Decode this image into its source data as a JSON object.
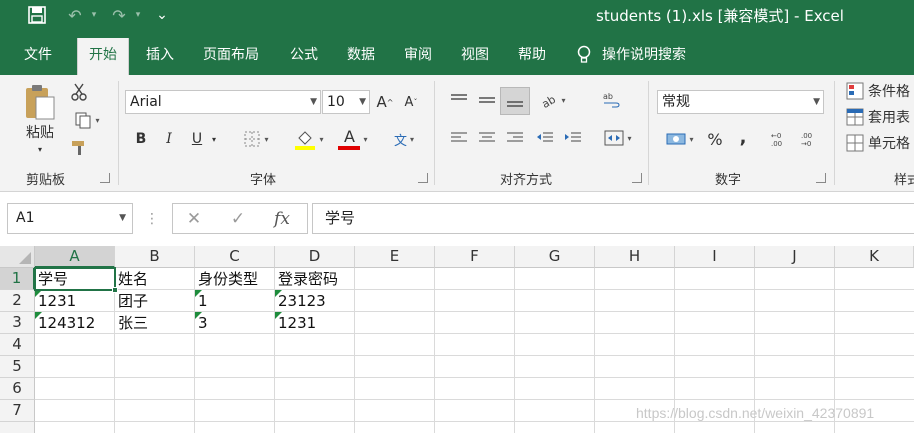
{
  "window": {
    "title": "students (1).xls  [兼容模式]  -  Excel"
  },
  "quick_access": {
    "save": "🖫",
    "undo": "↶",
    "redo": "↷",
    "customize": "⌄"
  },
  "tabs": [
    {
      "label": "文件"
    },
    {
      "label": "开始"
    },
    {
      "label": "插入"
    },
    {
      "label": "页面布局"
    },
    {
      "label": "公式"
    },
    {
      "label": "数据"
    },
    {
      "label": "审阅"
    },
    {
      "label": "视图"
    },
    {
      "label": "帮助"
    }
  ],
  "tell_me": {
    "label": "操作说明搜索"
  },
  "ribbon": {
    "clipboard": {
      "label": "剪贴板",
      "paste": "粘贴"
    },
    "font": {
      "label": "字体",
      "name": "Arial",
      "size": "10",
      "bold": "B",
      "italic": "I",
      "underline": "U",
      "grow": "A",
      "shrink": "A",
      "color": "A",
      "phonetic": "文"
    },
    "alignment": {
      "label": "对齐方式"
    },
    "number": {
      "label": "数字",
      "format": "常规",
      "percent": "%",
      "comma": ","
    },
    "styles": {
      "label": "样式",
      "conditional": "条件格",
      "table": "套用表",
      "cell": "单元格"
    }
  },
  "formula_bar": {
    "name_box": "A1",
    "cancel": "✕",
    "enter": "✓",
    "fx": "fx",
    "content": "学号"
  },
  "columns": [
    "A",
    "B",
    "C",
    "D",
    "E",
    "F",
    "G",
    "H",
    "I",
    "J",
    "K"
  ],
  "rows": [
    "1",
    "2",
    "3",
    "4",
    "5",
    "6",
    "7"
  ],
  "cells": {
    "r1": [
      "学号",
      "姓名",
      "身份类型",
      "登录密码"
    ],
    "r2": [
      "1231",
      "团子",
      "1",
      "23123"
    ],
    "r3": [
      "124312",
      "张三",
      "3",
      "1231"
    ]
  },
  "watermark": "https://blog.csdn.net/weixin_42370891",
  "colors": {
    "brand": "#217346",
    "error_triangle": "#1e8c3c"
  }
}
